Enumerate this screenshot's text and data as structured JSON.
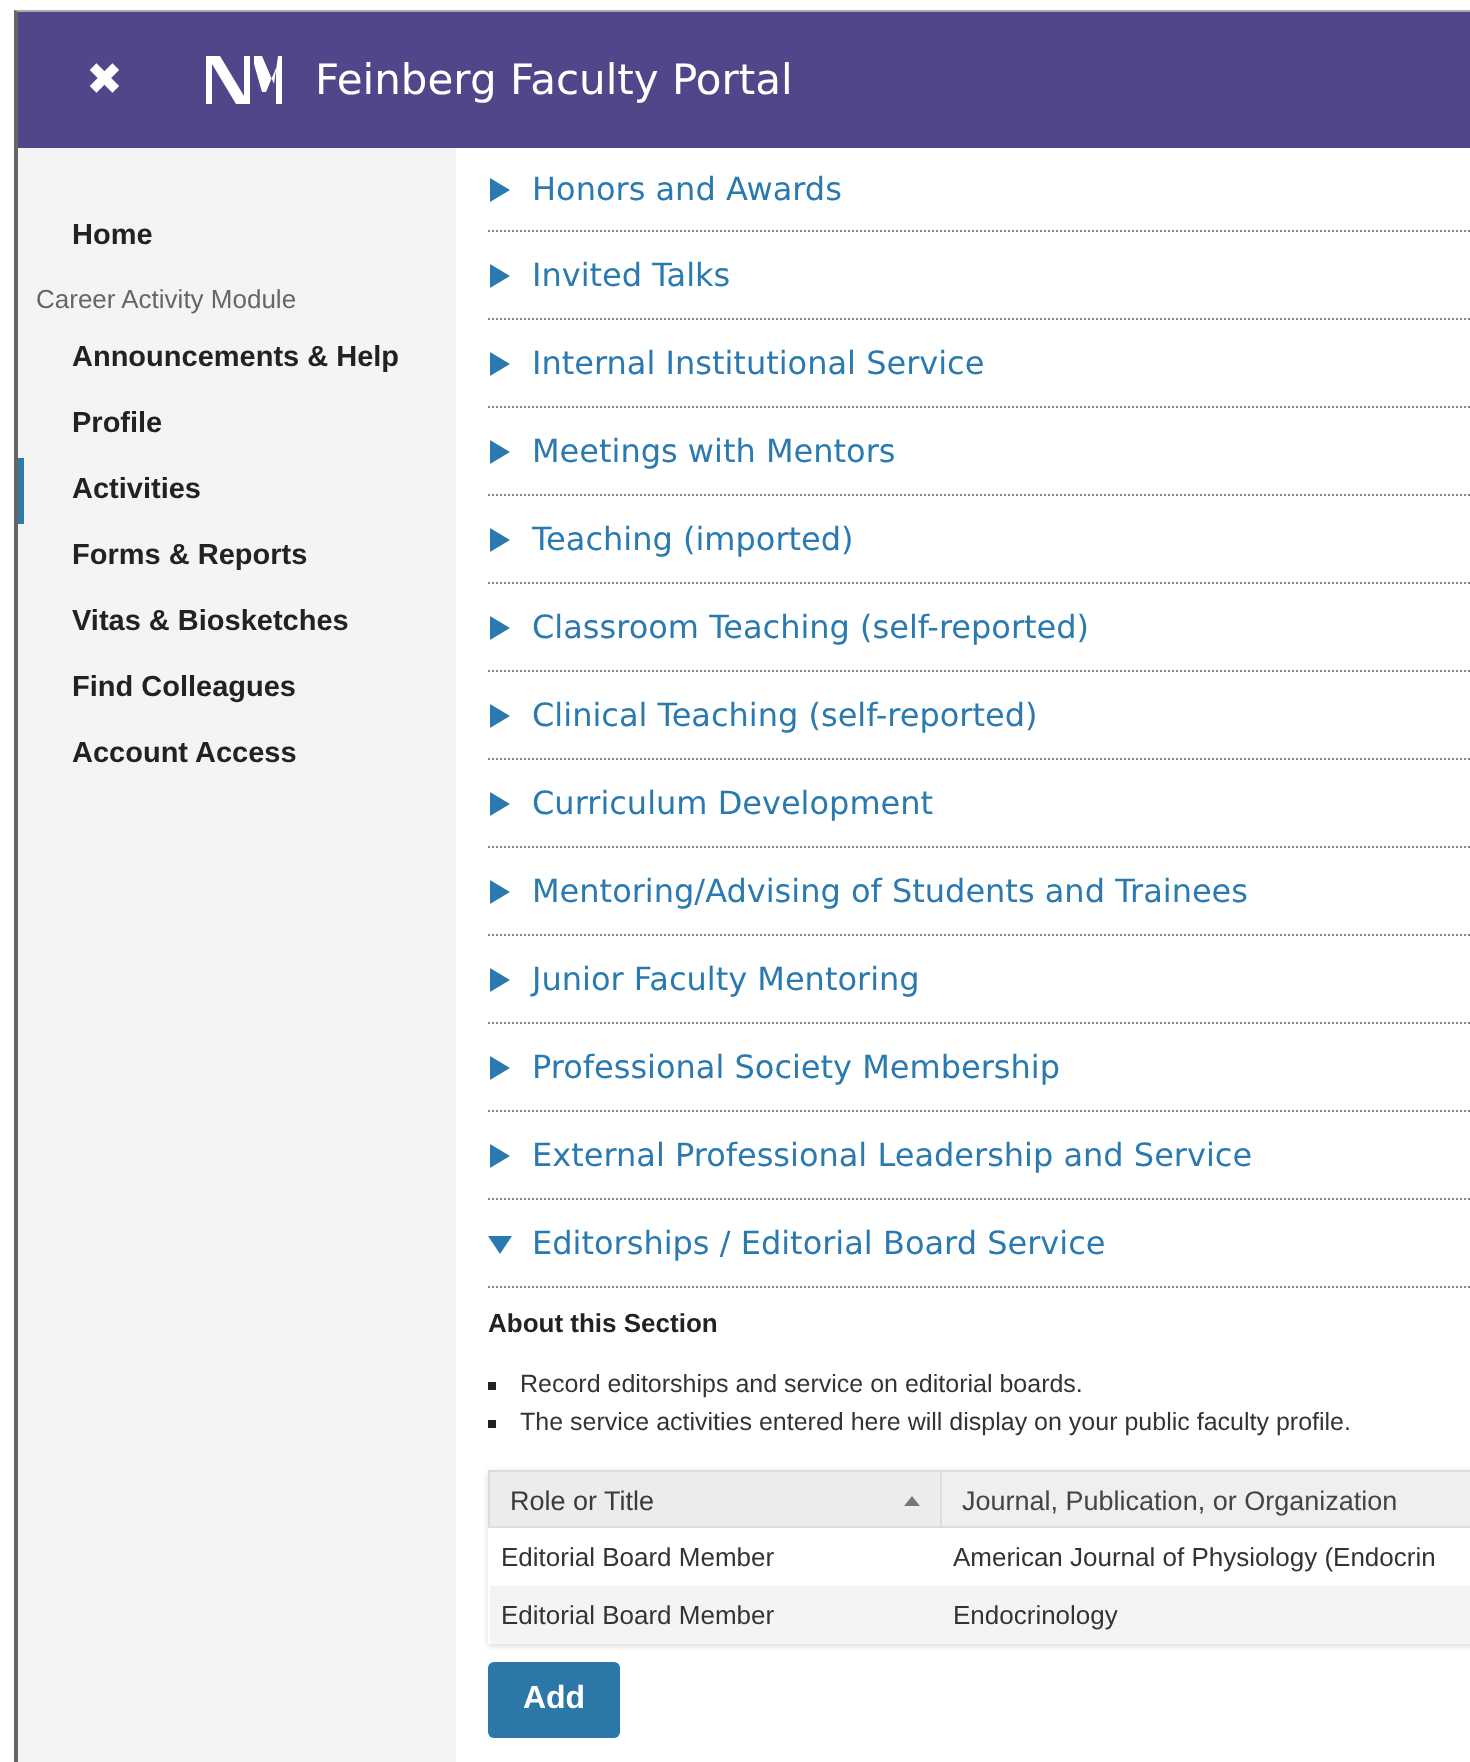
{
  "header": {
    "close_icon": "✖",
    "title": "Feinberg Faculty Portal"
  },
  "sidebar": {
    "items": [
      {
        "label": "Home",
        "kind": "link",
        "selected": false
      },
      {
        "label": "Career Activity Module",
        "kind": "heading"
      },
      {
        "label": "Announcements & Help",
        "kind": "link",
        "selected": false
      },
      {
        "label": "Profile",
        "kind": "link",
        "selected": false
      },
      {
        "label": "Activities",
        "kind": "link",
        "selected": true
      },
      {
        "label": "Forms & Reports",
        "kind": "link",
        "selected": false
      },
      {
        "label": "Vitas & Biosketches",
        "kind": "link",
        "selected": false
      },
      {
        "label": "Find Colleagues",
        "kind": "link",
        "selected": false
      },
      {
        "label": "Account Access",
        "kind": "link",
        "selected": false
      }
    ]
  },
  "sections": [
    {
      "title": "Honors and Awards",
      "expanded": false
    },
    {
      "title": "Invited Talks",
      "expanded": false
    },
    {
      "title": "Internal Institutional Service",
      "expanded": false
    },
    {
      "title": "Meetings with Mentors",
      "expanded": false
    },
    {
      "title": "Teaching (imported)",
      "expanded": false
    },
    {
      "title": "Classroom Teaching (self-reported)",
      "expanded": false
    },
    {
      "title": "Clinical Teaching (self-reported)",
      "expanded": false
    },
    {
      "title": "Curriculum Development",
      "expanded": false
    },
    {
      "title": "Mentoring/Advising of Students and Trainees",
      "expanded": false
    },
    {
      "title": "Junior Faculty Mentoring",
      "expanded": false
    },
    {
      "title": "Professional Society Membership",
      "expanded": false
    },
    {
      "title": "External Professional Leadership and Service",
      "expanded": false
    },
    {
      "title": "Editorships / Editorial Board Service",
      "expanded": true,
      "about": {
        "heading": "About this Section",
        "bullets": [
          "Record editorships and service on editorial boards.",
          "The service activities entered here will display on your public faculty profile."
        ]
      },
      "table": {
        "columns": [
          {
            "label": "Role or Title",
            "sorted": true
          },
          {
            "label": "Journal, Publication, or Organization",
            "sorted": false
          }
        ],
        "rows": [
          [
            "Editorial Board Member",
            "American Journal of Physiology (Endocrin"
          ],
          [
            "Editorial Board Member",
            "Endocrinology"
          ]
        ]
      },
      "add_button": "Add"
    }
  ]
}
